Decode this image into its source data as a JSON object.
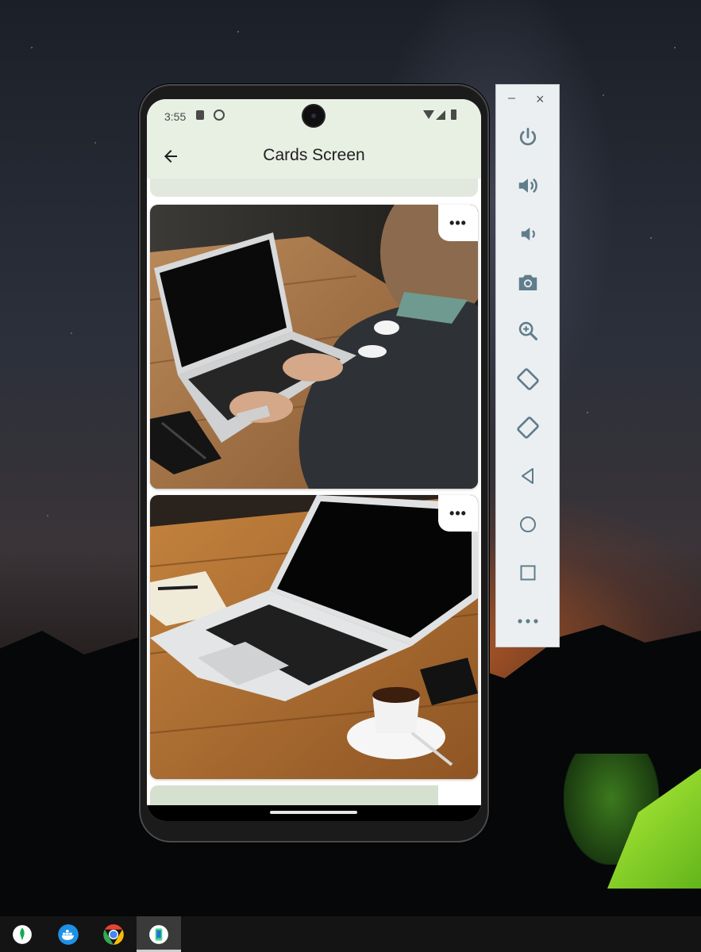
{
  "status_bar": {
    "time": "3:55"
  },
  "app_bar": {
    "title": "Cards Screen",
    "back_icon": "arrow-back-icon"
  },
  "cards": [
    {
      "photo": "laptop-typing-photo",
      "more_label": "•••"
    },
    {
      "photo": "laptop-coffee-photo",
      "more_label": "•••"
    }
  ],
  "emulator_toolbar": {
    "minimize_label": "–",
    "close_label": "×",
    "buttons": [
      "power-icon",
      "volume-up-icon",
      "volume-down-icon",
      "camera-icon",
      "zoom-icon",
      "rotate-left-icon",
      "rotate-right-icon",
      "back-icon",
      "home-icon",
      "overview-icon",
      "more-icon"
    ]
  },
  "taskbar": {
    "apps": [
      "mongodb-icon",
      "docker-icon",
      "chrome-icon",
      "android-emulator-icon"
    ]
  },
  "colors": {
    "app_bar_bg": "#e8efe3",
    "toolbar_bg": "#eceff1",
    "taskbar_bg": "#141414",
    "icon_gray": "#607d8b"
  }
}
